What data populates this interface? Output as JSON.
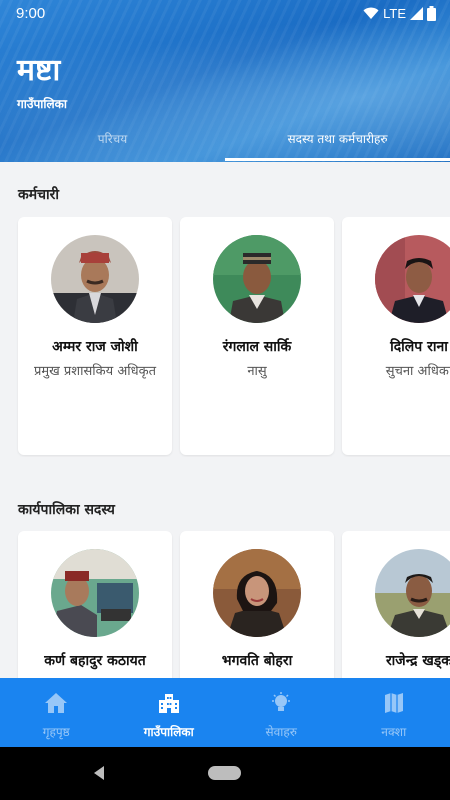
{
  "status": {
    "time": "9:00",
    "network": "LTE"
  },
  "header": {
    "title": "मष्टा",
    "subtitle": "गाउँपालिका",
    "tabs": [
      {
        "label": "परिचय",
        "active": false
      },
      {
        "label": "सदस्य तथा कर्मचारीहरु",
        "active": true
      }
    ]
  },
  "staff": {
    "title": "कर्मचारी",
    "cards": [
      {
        "name": "अम्मर राज जोशी",
        "role": "प्रमुख प्रशासकिय अधिकृत"
      },
      {
        "name": "रंगलाल सार्कि",
        "role": "नासु"
      },
      {
        "name": "दिलिप राना",
        "role": "सुचना अधिका"
      }
    ]
  },
  "members": {
    "title": "कार्यपालिका सदस्य",
    "cards": [
      {
        "name": "कर्ण बहादुर कठायत",
        "role": ""
      },
      {
        "name": "भगवति बोहरा",
        "role": ""
      },
      {
        "name": "राजेन्द्र खड्क",
        "role": ""
      }
    ]
  },
  "bottom_nav": [
    {
      "label": "गृहपृष्ठ",
      "icon": "home-icon",
      "active": false
    },
    {
      "label": "गाउँपालिका",
      "icon": "building-icon",
      "active": true
    },
    {
      "label": "सेवाहरु",
      "icon": "bulb-icon",
      "active": false
    },
    {
      "label": "नक्शा",
      "icon": "map-icon",
      "active": false
    }
  ],
  "colors": {
    "primary": "#1a84f0",
    "header": "#2a7dd2"
  }
}
